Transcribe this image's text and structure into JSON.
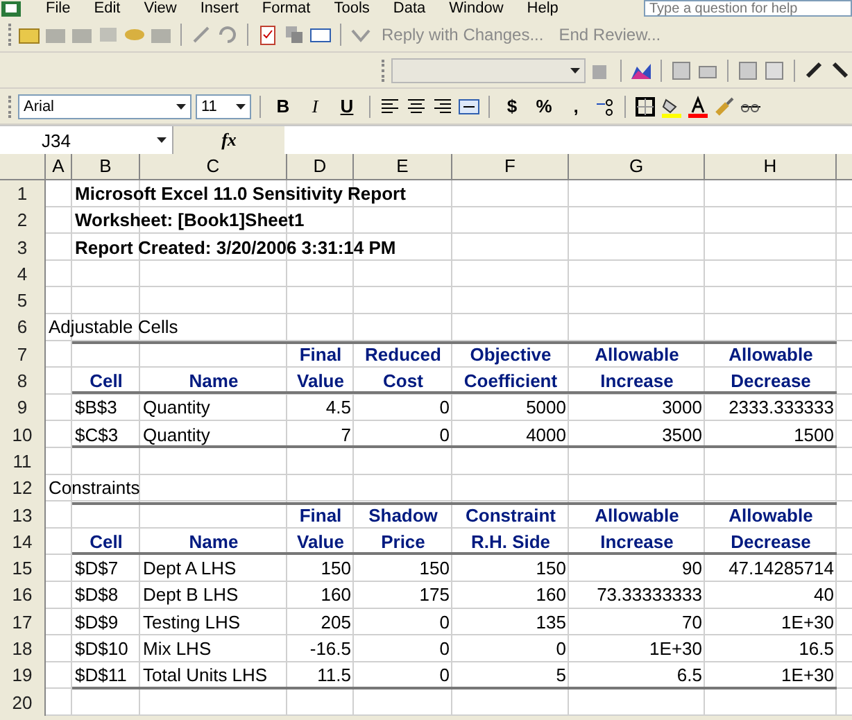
{
  "menu_bar": {
    "items": [
      "File",
      "Edit",
      "View",
      "Insert",
      "Format",
      "Tools",
      "Data",
      "Window",
      "Help"
    ],
    "help_box": {
      "placeholder": "Type a question for help"
    }
  },
  "reviewing_toolbar": {
    "reply_button": "Reply with Changes...",
    "end_review_button": "End Review..."
  },
  "formatting_toolbar": {
    "font": "Arial",
    "size": "11",
    "bold": "B",
    "italic": "I",
    "underline": "U",
    "currency": "$",
    "percent": "%",
    "comma": ","
  },
  "formula_bar": {
    "name_box": "J34",
    "fx": "fx"
  },
  "sheet": {
    "columns": [
      "A",
      "B",
      "C",
      "D",
      "E",
      "F",
      "G",
      "H"
    ],
    "row_numbers": [
      "1",
      "2",
      "3",
      "4",
      "5",
      "6",
      "7",
      "8",
      "9",
      "10",
      "11",
      "12",
      "13",
      "14",
      "15",
      "16",
      "17",
      "18",
      "19",
      "20"
    ],
    "title_lines": [
      "Microsoft Excel 11.0 Sensitivity Report",
      "Worksheet: [Book1]Sheet1",
      "Report Created: 3/20/2006 3:31:14 PM"
    ],
    "sections": [
      {
        "title": "Adjustable Cells",
        "headers": [
          [
            "Cell"
          ],
          [
            "Name"
          ],
          [
            "Final",
            "Value"
          ],
          [
            "Reduced",
            "Cost"
          ],
          [
            "Objective",
            "Coefficient"
          ],
          [
            "Allowable",
            "Increase"
          ],
          [
            "Allowable",
            "Decrease"
          ]
        ],
        "rows": [
          [
            "$B$3",
            "Quantity",
            "4.5",
            "0",
            "5000",
            "3000",
            "2333.333333"
          ],
          [
            "$C$3",
            "Quantity",
            "7",
            "0",
            "4000",
            "3500",
            "1500"
          ]
        ]
      },
      {
        "title": "Constraints",
        "headers": [
          [
            "Cell"
          ],
          [
            "Name"
          ],
          [
            "Final",
            "Value"
          ],
          [
            "Shadow",
            "Price"
          ],
          [
            "Constraint",
            "R.H. Side"
          ],
          [
            "Allowable",
            "Increase"
          ],
          [
            "Allowable",
            "Decrease"
          ]
        ],
        "rows": [
          [
            "$D$7",
            "Dept A LHS",
            "150",
            "150",
            "150",
            "90",
            "47.14285714"
          ],
          [
            "$D$8",
            "Dept B LHS",
            "160",
            "175",
            "160",
            "73.33333333",
            "40"
          ],
          [
            "$D$9",
            "Testing LHS",
            "205",
            "0",
            "135",
            "70",
            "1E+30"
          ],
          [
            "$D$10",
            "Mix LHS",
            "-16.5",
            "0",
            "0",
            "1E+30",
            "16.5"
          ],
          [
            "$D$11",
            "Total Units LHS",
            "11.5",
            "0",
            "5",
            "6.5",
            "1E+30"
          ]
        ]
      }
    ]
  }
}
